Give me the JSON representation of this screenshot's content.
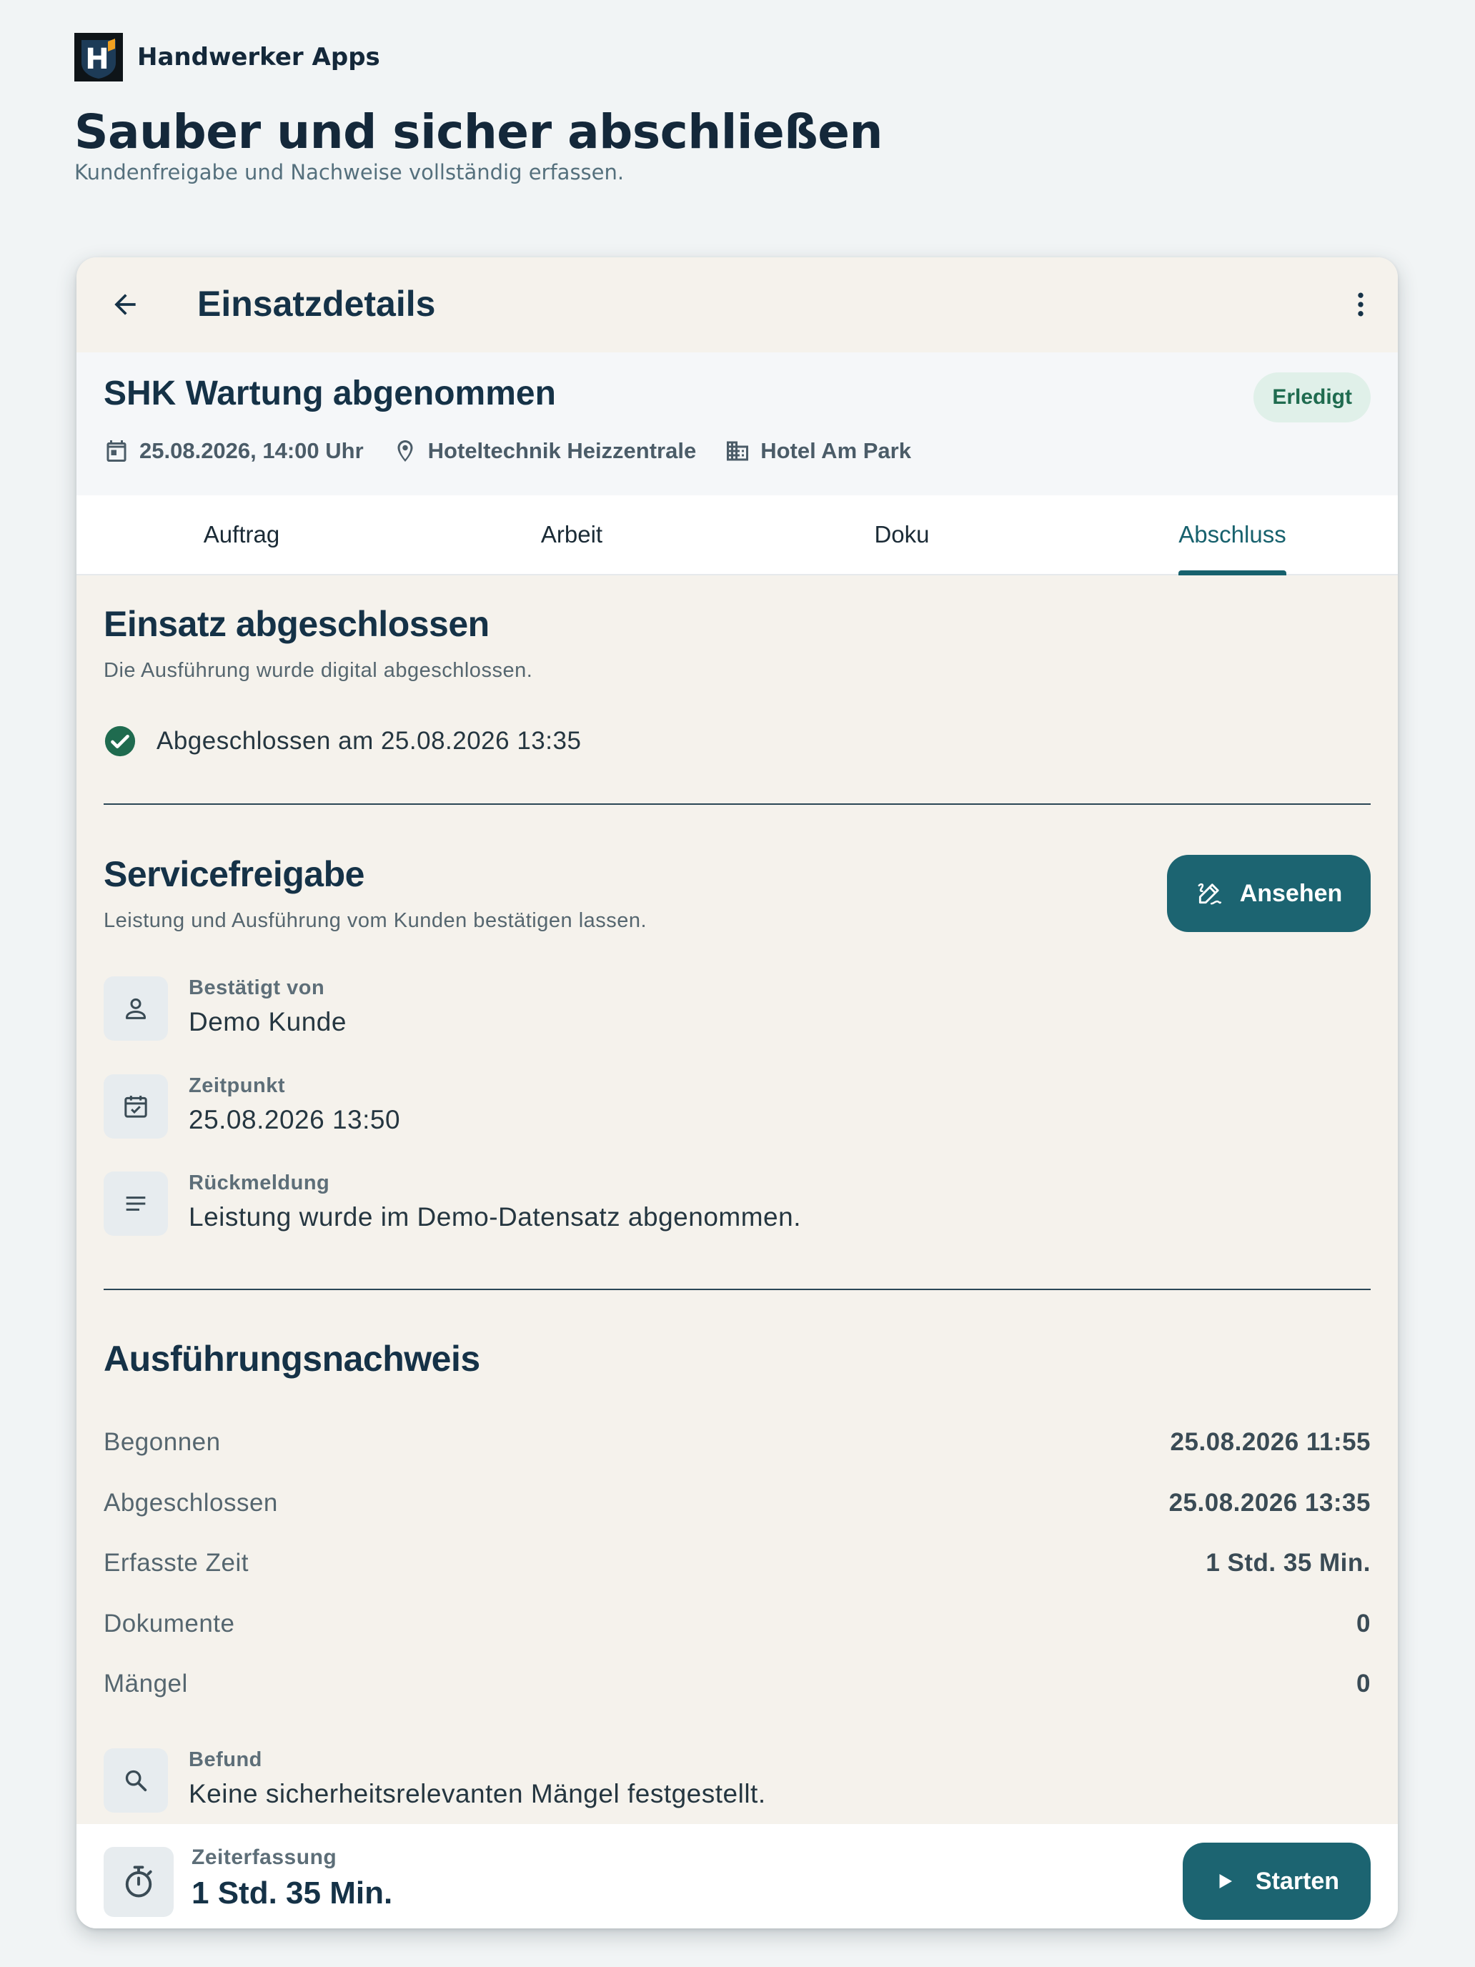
{
  "brand": {
    "name": "Handwerker Apps",
    "logo_letter": "H"
  },
  "hero": {
    "title": "Sauber und sicher abschließen",
    "subtitle": "Kundenfreigabe und Nachweise vollständig erfassen."
  },
  "appbar": {
    "title": "Einsatzdetails",
    "back_icon": "arrow-left-icon",
    "menu_icon": "more-vert-icon"
  },
  "job": {
    "title": "SHK Wartung abgenommen",
    "status": "Erledigt",
    "date": "25.08.2026, 14:00 Uhr",
    "location": "Hoteltechnik Heizzentrale",
    "customer": "Hotel Am Park"
  },
  "tabs": [
    {
      "label": "Auftrag"
    },
    {
      "label": "Arbeit"
    },
    {
      "label": "Doku"
    },
    {
      "label": "Abschluss",
      "active": true
    }
  ],
  "completion": {
    "title": "Einsatz abgeschlossen",
    "subtitle": "Die Ausführung wurde digital abgeschlossen.",
    "status_text": "Abgeschlossen am 25.08.2026 13:35"
  },
  "release": {
    "title": "Servicefreigabe",
    "subtitle": "Leistung und Ausführung vom Kunden bestätigen lassen.",
    "view_button": "Ansehen",
    "confirmed_by_label": "Bestätigt von",
    "confirmed_by": "Demo Kunde",
    "time_label": "Zeitpunkt",
    "time": "25.08.2026 13:50",
    "feedback_label": "Rückmeldung",
    "feedback": "Leistung wurde im Demo-Datensatz abgenommen."
  },
  "proof": {
    "title": "Ausführungsnachweis",
    "rows": [
      {
        "key": "Begonnen",
        "value": "25.08.2026 11:55"
      },
      {
        "key": "Abgeschlossen",
        "value": "25.08.2026 13:35"
      },
      {
        "key": "Erfasste Zeit",
        "value": "1 Std. 35 Min."
      },
      {
        "key": "Dokumente",
        "value": "0"
      },
      {
        "key": "Mängel",
        "value": "0"
      }
    ],
    "finding_label": "Befund",
    "finding": "Keine sicherheitsrelevanten Mängel festgestellt."
  },
  "timer": {
    "label": "Zeiterfassung",
    "value": "1 Std. 35 Min.",
    "start_button": "Starten"
  },
  "colors": {
    "primary": "#1c6471",
    "tab_active": "#17616d",
    "badge_bg": "#e0f0e9",
    "badge_text": "#1f6b4f",
    "success": "#1f6b4f",
    "card_bg": "#f5f2ec",
    "page_bg": "#f1f4f5",
    "logo_accent": "#f0a020"
  }
}
